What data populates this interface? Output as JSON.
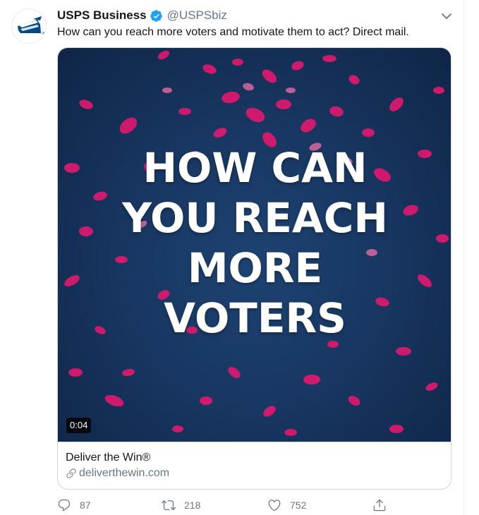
{
  "tweet": {
    "author": {
      "display_name": "USPS Business",
      "handle": "@USPSbiz",
      "verified": true,
      "avatar": "usps-eagle-logo"
    },
    "text": "How can you reach more voters and motivate them to act? Direct mail.",
    "menu_icon": "chevron-down-icon"
  },
  "media": {
    "headline_lines": [
      "HOW CAN",
      "YOU REACH",
      "MORE",
      "VOTERS"
    ],
    "duration": "0:04",
    "background_color": "#183762",
    "accent_color": "#e3186f"
  },
  "card": {
    "title": "Deliver the Win®",
    "domain": "deliverthewin.com",
    "domain_icon": "link-icon"
  },
  "actions": {
    "reply": {
      "icon": "reply-icon",
      "count": "87"
    },
    "retweet": {
      "icon": "retweet-icon",
      "count": "218"
    },
    "like": {
      "icon": "heart-icon",
      "count": "752"
    },
    "share": {
      "icon": "share-icon"
    }
  },
  "colors": {
    "text_primary": "#14171a",
    "text_secondary": "#657786",
    "verified_blue": "#1da1f2",
    "border": "#ccd6dd"
  }
}
